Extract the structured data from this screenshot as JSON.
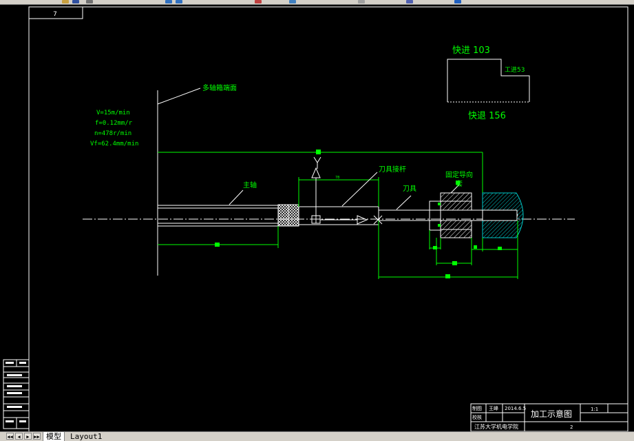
{
  "app": {
    "toolbar_icons": [
      "open-icon",
      "save-icon",
      "print-icon",
      "undo-icon",
      "redo-icon",
      "pan-icon",
      "zoom-icon",
      "properties-icon",
      "layer-icon",
      "help-icon"
    ]
  },
  "drawing": {
    "sheet_tag": "7",
    "rapid_advance": "快进 103",
    "work_feed": "工进53",
    "rapid_return": "快退 156",
    "multi_axis_face": "多轴箱端面",
    "spindle": "主轴",
    "tool_rod": "刀具接杆",
    "tool": "刀具",
    "fixed_guide_line1": "固定导向",
    "fixed_guide_line2": "套",
    "params": [
      "V=15m/min",
      "f=0.12mm/r",
      "n=478r/min",
      "Vf=62.4mm/min"
    ],
    "small_dim": "78",
    "title_block": {
      "title": "加工示意图",
      "scale": "1:1",
      "school": "江苏大学机电学院",
      "sheet_no": "2",
      "row1_label": "制图",
      "row1_name": "王峰",
      "row1_date": "2014.6.5",
      "row2_label": "校核"
    }
  },
  "colors": {
    "line": "#ffffff",
    "green_text": "#00ff00",
    "dim_green": "#00ff00",
    "grip": "#00ff00",
    "background": "#000000"
  },
  "tabs": {
    "model": "模型",
    "layout1": "Layout1"
  },
  "nav_buttons": [
    "◀◀",
    "◀",
    "▶",
    "▶▶"
  ]
}
